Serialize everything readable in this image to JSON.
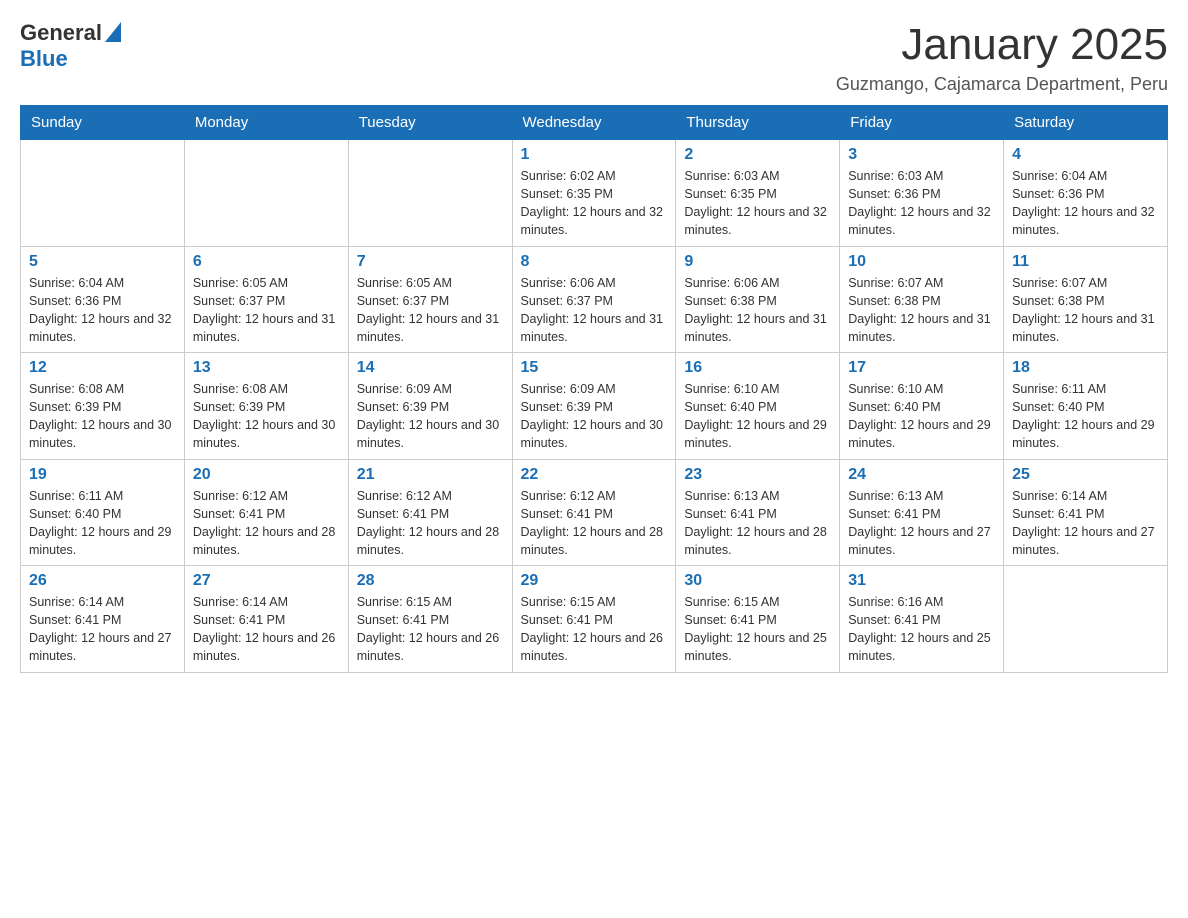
{
  "logo": {
    "general": "General",
    "blue": "Blue"
  },
  "title": "January 2025",
  "subtitle": "Guzmango, Cajamarca Department, Peru",
  "days_of_week": [
    "Sunday",
    "Monday",
    "Tuesday",
    "Wednesday",
    "Thursday",
    "Friday",
    "Saturday"
  ],
  "weeks": [
    [
      {
        "day": "",
        "info": ""
      },
      {
        "day": "",
        "info": ""
      },
      {
        "day": "",
        "info": ""
      },
      {
        "day": "1",
        "info": "Sunrise: 6:02 AM\nSunset: 6:35 PM\nDaylight: 12 hours and 32 minutes."
      },
      {
        "day": "2",
        "info": "Sunrise: 6:03 AM\nSunset: 6:35 PM\nDaylight: 12 hours and 32 minutes."
      },
      {
        "day": "3",
        "info": "Sunrise: 6:03 AM\nSunset: 6:36 PM\nDaylight: 12 hours and 32 minutes."
      },
      {
        "day": "4",
        "info": "Sunrise: 6:04 AM\nSunset: 6:36 PM\nDaylight: 12 hours and 32 minutes."
      }
    ],
    [
      {
        "day": "5",
        "info": "Sunrise: 6:04 AM\nSunset: 6:36 PM\nDaylight: 12 hours and 32 minutes."
      },
      {
        "day": "6",
        "info": "Sunrise: 6:05 AM\nSunset: 6:37 PM\nDaylight: 12 hours and 31 minutes."
      },
      {
        "day": "7",
        "info": "Sunrise: 6:05 AM\nSunset: 6:37 PM\nDaylight: 12 hours and 31 minutes."
      },
      {
        "day": "8",
        "info": "Sunrise: 6:06 AM\nSunset: 6:37 PM\nDaylight: 12 hours and 31 minutes."
      },
      {
        "day": "9",
        "info": "Sunrise: 6:06 AM\nSunset: 6:38 PM\nDaylight: 12 hours and 31 minutes."
      },
      {
        "day": "10",
        "info": "Sunrise: 6:07 AM\nSunset: 6:38 PM\nDaylight: 12 hours and 31 minutes."
      },
      {
        "day": "11",
        "info": "Sunrise: 6:07 AM\nSunset: 6:38 PM\nDaylight: 12 hours and 31 minutes."
      }
    ],
    [
      {
        "day": "12",
        "info": "Sunrise: 6:08 AM\nSunset: 6:39 PM\nDaylight: 12 hours and 30 minutes."
      },
      {
        "day": "13",
        "info": "Sunrise: 6:08 AM\nSunset: 6:39 PM\nDaylight: 12 hours and 30 minutes."
      },
      {
        "day": "14",
        "info": "Sunrise: 6:09 AM\nSunset: 6:39 PM\nDaylight: 12 hours and 30 minutes."
      },
      {
        "day": "15",
        "info": "Sunrise: 6:09 AM\nSunset: 6:39 PM\nDaylight: 12 hours and 30 minutes."
      },
      {
        "day": "16",
        "info": "Sunrise: 6:10 AM\nSunset: 6:40 PM\nDaylight: 12 hours and 29 minutes."
      },
      {
        "day": "17",
        "info": "Sunrise: 6:10 AM\nSunset: 6:40 PM\nDaylight: 12 hours and 29 minutes."
      },
      {
        "day": "18",
        "info": "Sunrise: 6:11 AM\nSunset: 6:40 PM\nDaylight: 12 hours and 29 minutes."
      }
    ],
    [
      {
        "day": "19",
        "info": "Sunrise: 6:11 AM\nSunset: 6:40 PM\nDaylight: 12 hours and 29 minutes."
      },
      {
        "day": "20",
        "info": "Sunrise: 6:12 AM\nSunset: 6:41 PM\nDaylight: 12 hours and 28 minutes."
      },
      {
        "day": "21",
        "info": "Sunrise: 6:12 AM\nSunset: 6:41 PM\nDaylight: 12 hours and 28 minutes."
      },
      {
        "day": "22",
        "info": "Sunrise: 6:12 AM\nSunset: 6:41 PM\nDaylight: 12 hours and 28 minutes."
      },
      {
        "day": "23",
        "info": "Sunrise: 6:13 AM\nSunset: 6:41 PM\nDaylight: 12 hours and 28 minutes."
      },
      {
        "day": "24",
        "info": "Sunrise: 6:13 AM\nSunset: 6:41 PM\nDaylight: 12 hours and 27 minutes."
      },
      {
        "day": "25",
        "info": "Sunrise: 6:14 AM\nSunset: 6:41 PM\nDaylight: 12 hours and 27 minutes."
      }
    ],
    [
      {
        "day": "26",
        "info": "Sunrise: 6:14 AM\nSunset: 6:41 PM\nDaylight: 12 hours and 27 minutes."
      },
      {
        "day": "27",
        "info": "Sunrise: 6:14 AM\nSunset: 6:41 PM\nDaylight: 12 hours and 26 minutes."
      },
      {
        "day": "28",
        "info": "Sunrise: 6:15 AM\nSunset: 6:41 PM\nDaylight: 12 hours and 26 minutes."
      },
      {
        "day": "29",
        "info": "Sunrise: 6:15 AM\nSunset: 6:41 PM\nDaylight: 12 hours and 26 minutes."
      },
      {
        "day": "30",
        "info": "Sunrise: 6:15 AM\nSunset: 6:41 PM\nDaylight: 12 hours and 25 minutes."
      },
      {
        "day": "31",
        "info": "Sunrise: 6:16 AM\nSunset: 6:41 PM\nDaylight: 12 hours and 25 minutes."
      },
      {
        "day": "",
        "info": ""
      }
    ]
  ]
}
